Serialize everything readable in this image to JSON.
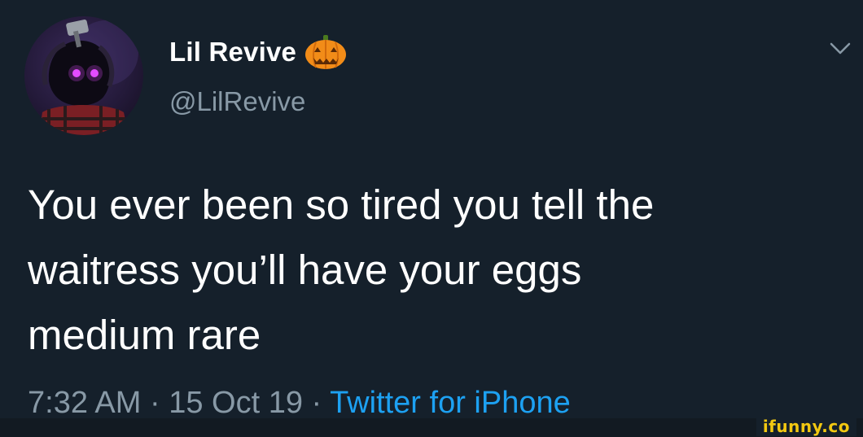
{
  "user": {
    "display_name": "Lil Revive",
    "handle": "@LilRevive",
    "avatar_icon": "hooded-figure-avatar",
    "name_emoji_icon": "jack-o-lantern-icon"
  },
  "tweet": {
    "text": "You ever been so tired you tell the\nwaitress you’ll have your eggs\nmedium rare",
    "time": "7:32 AM",
    "separator": "·",
    "date": "15 Oct 19",
    "source": "Twitter for iPhone"
  },
  "watermark": "ifunny.co",
  "colors": {
    "background": "#15202b",
    "primary_text": "#ffffff",
    "secondary_text": "#8899a6",
    "link": "#1da1f2",
    "watermark": "#f2c811"
  }
}
